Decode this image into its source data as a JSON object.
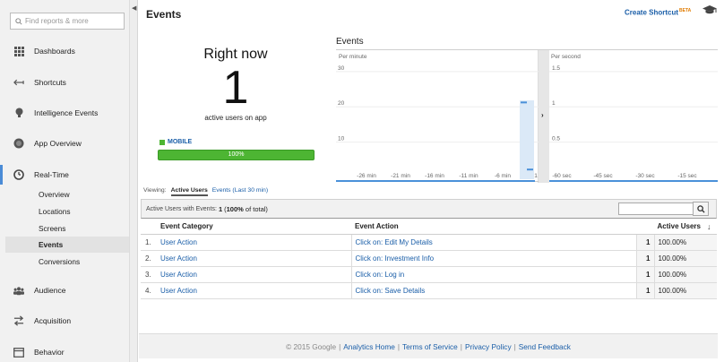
{
  "sidebar": {
    "search_placeholder": "Find reports & more",
    "items": [
      {
        "label": "Dashboards",
        "icon": "grid-icon"
      },
      {
        "label": "Shortcuts",
        "icon": "arrow-icon"
      },
      {
        "label": "Intelligence Events",
        "icon": "lightbulb-icon"
      },
      {
        "label": "App Overview",
        "icon": "circle-icon"
      },
      {
        "label": "Real-Time",
        "icon": "clock-icon"
      },
      {
        "label": "Audience",
        "icon": "people-icon"
      },
      {
        "label": "Acquisition",
        "icon": "swap-arrows-icon"
      },
      {
        "label": "Behavior",
        "icon": "window-icon"
      }
    ],
    "realtime_sub": [
      "Overview",
      "Locations",
      "Screens",
      "Events",
      "Conversions"
    ]
  },
  "header": {
    "title": "Events",
    "shortcut_label": "Create Shortcut",
    "shortcut_badge": "BETA"
  },
  "right_now": {
    "title": "Right now",
    "value": "1",
    "caption": "active users on app",
    "segment_label": "MOBILE",
    "segment_percent": "100%",
    "segment_color": "#4db533"
  },
  "chart_data": {
    "type": "bar",
    "title": "Events",
    "panels": [
      {
        "name": "Per minute",
        "x_ticks": [
          "-26 min",
          "-21 min",
          "-16 min",
          "-11 min",
          "-6 min",
          "-1"
        ],
        "y_ticks": [
          10,
          20,
          30
        ],
        "ylim": [
          0,
          33
        ],
        "bars": [
          {
            "x": "-2 min",
            "value": 22
          },
          {
            "x": "-1 min",
            "value": 3
          }
        ],
        "note_value": "-1"
      },
      {
        "name": "Per second",
        "x_ticks": [
          "-60 sec",
          "-45 sec",
          "-30 sec",
          "-15 sec"
        ],
        "y_ticks": [
          0.5,
          1,
          1.5
        ],
        "ylim": [
          0,
          1.65
        ],
        "bars": []
      }
    ],
    "bar_color": "#4a90d9",
    "highlight_color": "#dbe9f7"
  },
  "viewing": {
    "label": "Viewing:",
    "active_tab": "Active Users",
    "other_tab": "Events (Last 30 min)"
  },
  "summary": {
    "label": "Active Users with Events:",
    "value": "1",
    "detail": "(100% of total)",
    "detail_bold": "100%"
  },
  "table": {
    "columns": [
      "Event Category",
      "Event Action",
      "Active Users"
    ],
    "rows": [
      {
        "idx": "1.",
        "category": "User Action",
        "action": "Click on: Edit My Details",
        "users": "1",
        "pct": "100.00%"
      },
      {
        "idx": "2.",
        "category": "User Action",
        "action": "Click on: Investment Info",
        "users": "1",
        "pct": "100.00%"
      },
      {
        "idx": "3.",
        "category": "User Action",
        "action": "Click on: Log in",
        "users": "1",
        "pct": "100.00%"
      },
      {
        "idx": "4.",
        "category": "User Action",
        "action": "Click on: Save Details",
        "users": "1",
        "pct": "100.00%"
      }
    ]
  },
  "footer": {
    "copyright": "© 2015 Google",
    "links": [
      "Analytics Home",
      "Terms of Service",
      "Privacy Policy",
      "Send Feedback"
    ]
  }
}
